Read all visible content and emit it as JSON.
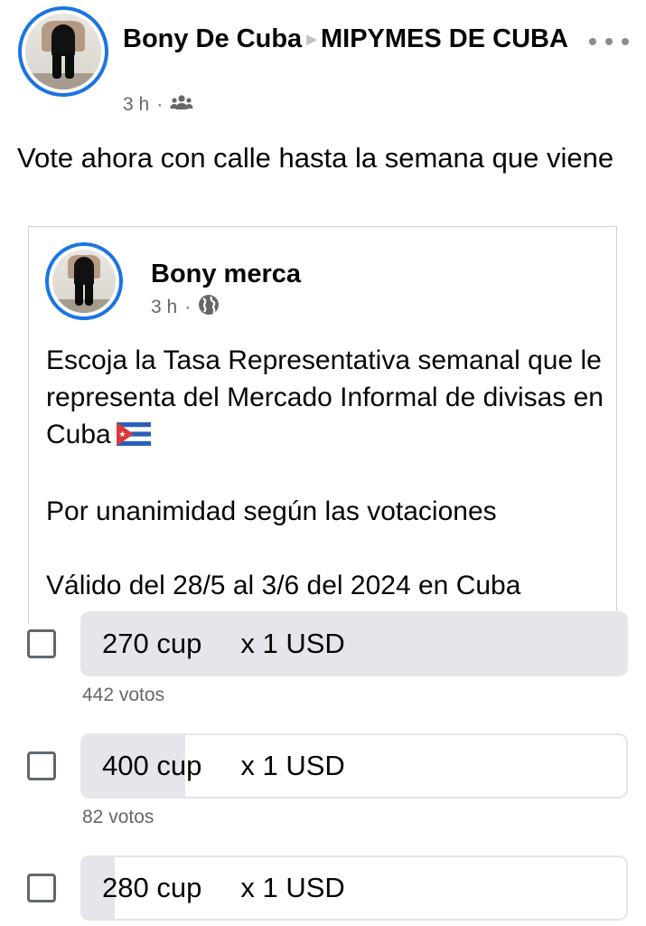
{
  "header": {
    "author": "Bony De Cuba",
    "group": "MIPYMES DE CUBA",
    "time": "3 h",
    "separator": "·",
    "audience_icon": "group-icon"
  },
  "post": {
    "text": "Vote ahora con calle hasta la semana que viene"
  },
  "shared": {
    "author": "Bony merca",
    "time": "3 h",
    "separator": "·",
    "audience_icon": "globe-icon",
    "paragraphs": [
      "Escoja la Tasa Representativa semanal que le representa del Mercado Informal de divisas en Cuba",
      "Por unanimidad según las votaciones",
      "Válido del 28/5 al 3/6 del 2024 en Cuba"
    ],
    "flag_icon": "cuba-flag-icon"
  },
  "poll": {
    "options": [
      {
        "label": "270 cup     x 1 USD",
        "votes": "442 votos",
        "fill": 1.0
      },
      {
        "label": "400 cup     x 1 USD",
        "votes": "82 votos",
        "fill": 0.19
      },
      {
        "label": "280 cup     x 1 USD",
        "votes": "",
        "fill": 0.06
      }
    ]
  }
}
